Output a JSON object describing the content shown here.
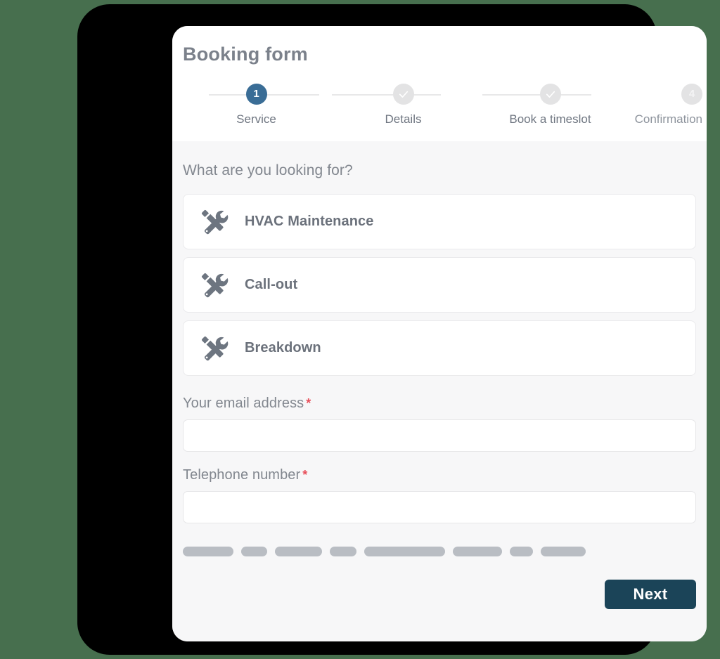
{
  "header": {
    "title": "Booking form"
  },
  "stepper": {
    "steps": [
      {
        "id": "service",
        "badge": "1",
        "label": "Service",
        "state": "active"
      },
      {
        "id": "details",
        "badge": "",
        "label": "Details",
        "state": "done"
      },
      {
        "id": "timeslot",
        "badge": "",
        "label": "Book a timeslot",
        "state": "done"
      },
      {
        "id": "confirmation",
        "badge": "4",
        "label": "Confirmation",
        "state": "upcoming"
      }
    ],
    "active_color": "#3a6d96",
    "inactive_color": "#e3e3e4",
    "connector_color": "#e8e8e9"
  },
  "main": {
    "question": "What are you looking for?",
    "service_options": [
      {
        "icon": "tools-icon",
        "label": "HVAC Maintenance"
      },
      {
        "icon": "tools-icon",
        "label": "Call-out"
      },
      {
        "icon": "tools-icon",
        "label": "Breakdown"
      }
    ],
    "fields": [
      {
        "id": "email",
        "label": "Your email address",
        "required_mark": "*",
        "value": "",
        "placeholder": ""
      },
      {
        "id": "telephone",
        "label": "Telephone number",
        "required_mark": "*",
        "value": "",
        "placeholder": ""
      }
    ],
    "skeleton_bars": [
      {
        "width": 72
      },
      {
        "width": 37
      },
      {
        "width": 67
      },
      {
        "width": 38
      },
      {
        "width": 115
      },
      {
        "width": 70
      },
      {
        "width": 33
      },
      {
        "width": 64
      }
    ],
    "skeleton_color": "#b9bdc3"
  },
  "footer": {
    "next_label": "Next",
    "next_color": "#1b4458"
  },
  "theme": {
    "page_background": "#476f4e",
    "bezel": "#000000",
    "card_background": "#ffffff",
    "body_background": "#f7f7f8",
    "text_muted": "#82878f",
    "text_strong": "#6b717b",
    "required_color": "#e8505b",
    "icon_color": "#6d7580"
  }
}
